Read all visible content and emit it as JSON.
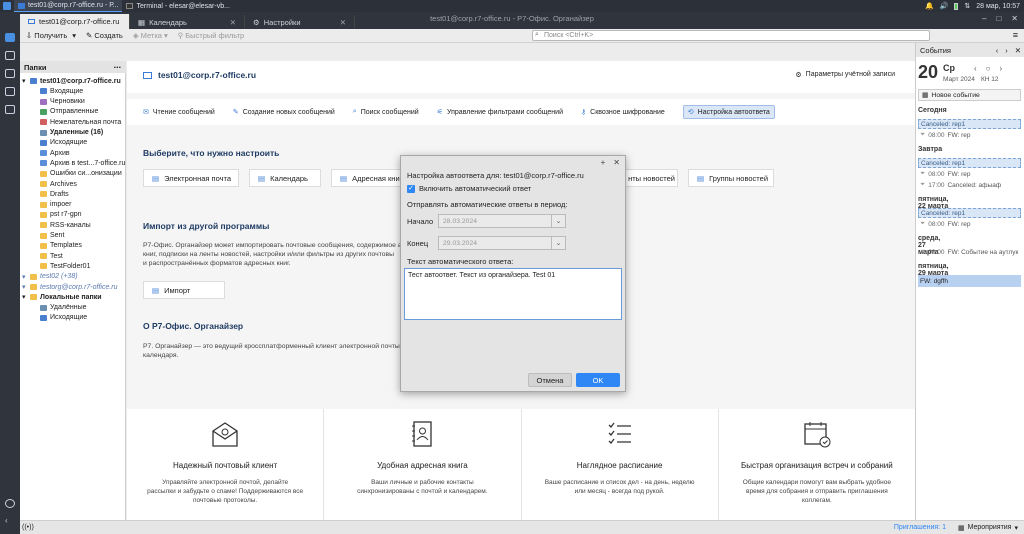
{
  "taskbar": {
    "windows": [
      {
        "label": "test01@corp.r7-office.ru - Р...",
        "active": true
      },
      {
        "label": "Terminal - elesar@elesar-vb...",
        "active": false
      }
    ],
    "datetime": "28 мар, 10:57"
  },
  "window": {
    "title": "test01@corp.r7-office.ru - Р7-Офис. Органайзер",
    "tabs": [
      {
        "label": "test01@corp.r7-office.ru",
        "active": true
      },
      {
        "label": "Календарь",
        "active": false
      },
      {
        "label": "Настройки",
        "active": false
      }
    ]
  },
  "toolbar": {
    "receive": "Получить",
    "compose": "Создать",
    "tag": "Метка",
    "quick_filter": "Быстрый фильтр",
    "search_placeholder": "Поиск <Ctrl+K>"
  },
  "folders": {
    "header": "Папки",
    "items": [
      {
        "label": "test01@corp.r7-office.ru",
        "bold": true,
        "indent": 0,
        "color": "#4a7fd0"
      },
      {
        "label": "Входящие",
        "indent": 1,
        "color": "#4a7fd0"
      },
      {
        "label": "Черновики",
        "indent": 1,
        "color": "#a070c0"
      },
      {
        "label": "Отправленные",
        "indent": 1,
        "color": "#4aa060"
      },
      {
        "label": "Нежелательная почта",
        "indent": 1,
        "color": "#d06060"
      },
      {
        "label": "Удаленные (16)",
        "bold": true,
        "indent": 1,
        "color": "#6a8fb0"
      },
      {
        "label": "Исходящие",
        "indent": 1,
        "color": "#4a7fd0"
      },
      {
        "label": "Архив",
        "indent": 1,
        "color": "#5a8ed8"
      },
      {
        "label": "Архив в test...7-office.ru",
        "indent": 1,
        "color": "#5a8ed8"
      },
      {
        "label": "Ошибки си...онизации",
        "indent": 1,
        "color": "#f0c04a"
      },
      {
        "label": "Archives",
        "indent": 1,
        "color": "#f0c04a"
      },
      {
        "label": "Drafts",
        "indent": 1,
        "color": "#f0c04a"
      },
      {
        "label": "impoer",
        "indent": 1,
        "color": "#f0c04a"
      },
      {
        "label": "pst r7-gpn",
        "indent": 1,
        "color": "#f0c04a"
      },
      {
        "label": "RSS-каналы",
        "indent": 1,
        "color": "#f0c04a"
      },
      {
        "label": "Sent",
        "indent": 1,
        "color": "#f0c04a"
      },
      {
        "label": "Templates",
        "indent": 1,
        "color": "#f0c04a"
      },
      {
        "label": "Test",
        "indent": 1,
        "color": "#f0c04a"
      },
      {
        "label": "TestFolder01",
        "indent": 1,
        "color": "#f0c04a"
      },
      {
        "label": "test02 (+38)",
        "indent": 0,
        "italic": true,
        "color": "#f0c04a"
      },
      {
        "label": "testorg@corp.r7-office.ru",
        "indent": 0,
        "italic": true,
        "color": "#f0c04a"
      },
      {
        "label": "Локальные папки",
        "bold": true,
        "indent": 0,
        "color": "#f0c04a"
      },
      {
        "label": "Удалённые",
        "indent": 1,
        "color": "#6a8fb0"
      },
      {
        "label": "Исходящие",
        "indent": 1,
        "color": "#4a7fd0"
      }
    ]
  },
  "main": {
    "account": "test01@corp.r7-office.ru",
    "account_settings": "Параметры учётной записи",
    "tools": [
      {
        "label": "Чтение сообщений",
        "selected": false
      },
      {
        "label": "Создание новых сообщений",
        "selected": false
      },
      {
        "label": "Поиск сообщений",
        "selected": false
      },
      {
        "label": "Управление фильтрами сообщений",
        "selected": false
      },
      {
        "label": "Сквозное шифрование",
        "selected": false
      },
      {
        "label": "Настройка автоответа",
        "selected": true
      }
    ],
    "setup_title": "Выберите, что нужно настроить",
    "setup_cards": [
      "Электронная почта",
      "Календарь",
      "Адресная кни",
      "нты новостей",
      "Группы новостей"
    ],
    "import_title": "Импорт из другой программы",
    "import_text": [
      "Р7-Офис. Органайзер может импортировать почтовые сообщения, содержимое а",
      "книг, подписки на ленты новостей, настройки и/или фильтры из других почтовы",
      "и распространённых форматов адресных книг."
    ],
    "import_button": "Импорт",
    "about_title": "О Р7-Офис. Органайзер",
    "about_text": [
      "Р7. Органайзер — это ведущий кроссплатформенный клиент электронной почты",
      "календаря."
    ],
    "promo": [
      {
        "title": "Надежный почтовый клиент",
        "desc": "Управляйте электронной почтой, делайте рассылки и забудьте о спаме! Поддерживаются все почтовые протоколы."
      },
      {
        "title": "Удобная адресная книга",
        "desc": "Ваши личные и рабочие контакты синхронизированы с почтой и календарем."
      },
      {
        "title": "Наглядное расписание",
        "desc": "Ваше расписание и список дел - на день, неделю или месяц - всегда под рукой."
      },
      {
        "title": "Быстрая организация встреч и собраний",
        "desc": "Общие календари помогут вам выбрать удобное время для собрания и отправить приглашения коллегам."
      }
    ]
  },
  "events": {
    "header": "События",
    "day_number": "20",
    "weekday": "Ср",
    "month_year": "Март 2024",
    "week": "КН 12",
    "new_event": "Новое событие",
    "groups": [
      {
        "day": "Сегодня",
        "items": [
          {
            "kind": "canceled",
            "label": "Canceled: rep1"
          },
          {
            "kind": "timed",
            "time": "08:00",
            "label": "FW: rep"
          }
        ]
      },
      {
        "day": "Завтра",
        "items": [
          {
            "kind": "canceled",
            "label": "Canceled: rep1"
          },
          {
            "kind": "timed",
            "time": "08:00",
            "label": "FW: rep"
          },
          {
            "kind": "timed",
            "time": "17:00",
            "label": "Canceled: афыаф"
          }
        ]
      },
      {
        "day": "пятница, 22 марта",
        "items": [
          {
            "kind": "canceled",
            "label": "Canceled: rep1"
          },
          {
            "kind": "timed",
            "time": "08:00",
            "label": "FW: rep"
          }
        ]
      },
      {
        "day": "среда, 27 марта",
        "items": [
          {
            "kind": "timed",
            "time": "08:00",
            "label": "FW: Событие на аутлук"
          }
        ]
      },
      {
        "day": "пятница, 29 марта",
        "items": [
          {
            "kind": "selected",
            "label": "FW: dgffh"
          }
        ]
      }
    ]
  },
  "status": {
    "invites": "Приглашения: 1",
    "events_btn": "Мероприятия"
  },
  "dialog": {
    "title": "Настройка автоответа для: test01@corp.r7-office.ru",
    "enable_label": "Включить автоматический ответ",
    "enabled": true,
    "period_label": "Отправлять автоматические ответы в период:",
    "start_label": "Начало",
    "start_value": "28.03.2024",
    "end_label": "Конец",
    "end_value": "29.03.2024",
    "text_label": "Текст автоматического ответа:",
    "text_value": "Тест автоответ. Текст из органайзера. Test 01",
    "cancel": "Отмена",
    "ok": "OK"
  },
  "colors": {
    "accent": "#2f87f5",
    "title_dark": "#1f3b63"
  }
}
